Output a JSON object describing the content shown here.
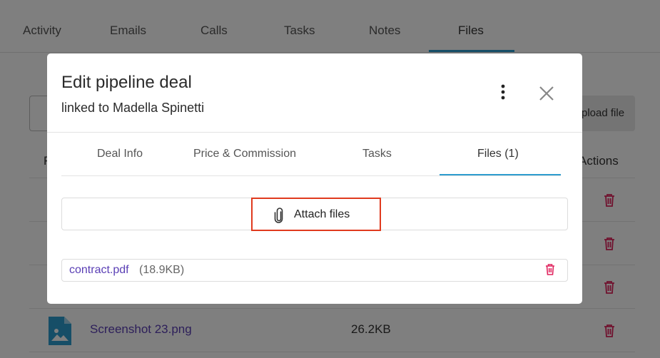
{
  "background": {
    "tabs": [
      {
        "label": "Activity"
      },
      {
        "label": "Emails"
      },
      {
        "label": "Calls"
      },
      {
        "label": "Tasks"
      },
      {
        "label": "Notes"
      },
      {
        "label": "Files"
      }
    ],
    "active_tab": "Files",
    "upload_button_label": "pload file",
    "table": {
      "first_header": "F",
      "actions_header": "Actions",
      "rows": [
        {
          "name": "Screenshot 23.png",
          "size": "26.2KB"
        }
      ]
    }
  },
  "modal": {
    "title": "Edit pipeline deal",
    "subtitle": "linked to Madella Spinetti",
    "tabs": [
      {
        "label": "Deal Info"
      },
      {
        "label": "Price & Commission"
      },
      {
        "label": "Tasks"
      },
      {
        "label": "Files (1)"
      }
    ],
    "active_tab": "Files (1)",
    "attach_label": "Attach files",
    "files": [
      {
        "name": "contract.pdf",
        "size": "(18.9KB)"
      }
    ]
  },
  "colors": {
    "accent": "#2d9ccf",
    "link": "#5a3fb5",
    "delete": "#e0245e",
    "highlight": "#e03a1e"
  }
}
